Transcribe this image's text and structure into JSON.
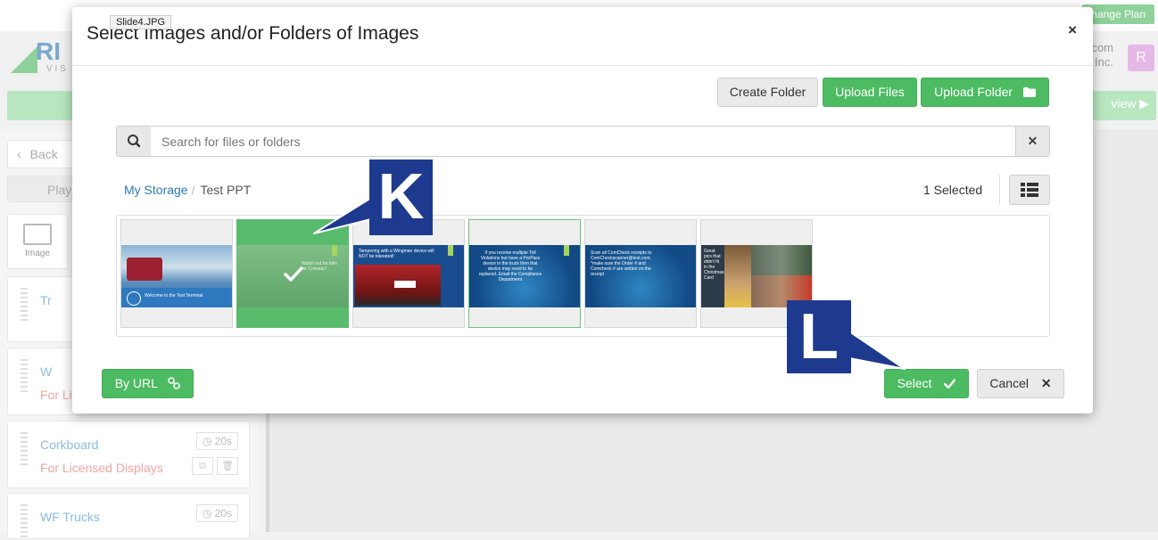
{
  "background": {
    "change_plan": "hange Plan",
    "brand_letters": "RI",
    "brand_sub": "V I S",
    "account_line1": "l.com",
    "account_line2": "t, Inc.",
    "avatar_letter": "R",
    "preview_label": "view ▶",
    "back_label": "Back",
    "play_label": "Play",
    "image_tile_label": "Image",
    "playlist_items": [
      {
        "name": "Tr",
        "sub": "",
        "duration": ""
      },
      {
        "name": "W",
        "sub": "For Li",
        "duration": ""
      },
      {
        "name": "Corkboard",
        "sub": "For Licensed Displays",
        "duration": "20s"
      },
      {
        "name": "WF Trucks",
        "sub": "",
        "duration": "20s"
      }
    ]
  },
  "modal": {
    "tooltip": "Slide4.JPG",
    "title": "Select Images and/or Folders of Images",
    "close": "×",
    "buttons": {
      "create_folder": "Create Folder",
      "upload_files": "Upload Files",
      "upload_folder": "Upload Folder"
    },
    "search": {
      "placeholder": "Search for files or folders",
      "value": ""
    },
    "breadcrumb": {
      "root": "My Storage",
      "separator": "/",
      "current": "Test PPT"
    },
    "selected_count": "1 Selected",
    "thumbnails": [
      {
        "caption": "Welcome to the Test Terminal",
        "state": "normal"
      },
      {
        "caption": "Watch out for tolls for Coinstac!",
        "state": "selected"
      },
      {
        "caption": "Tampering with a Wingman device will NOT be tolerated!",
        "state": "normal"
      },
      {
        "caption": "If you receive multiple Toll Violations but have a PrePass device in the truck then that device may need to be replaced. Email the Compliance Department",
        "state": "hover"
      },
      {
        "caption": "Scan all ComCheck receipts to ComCheckscanner@test.com. *make sure the Order # and Comcheck # are written on the receipt",
        "state": "normal"
      },
      {
        "caption": "Great pics that didn't fit in the Christmas Card",
        "state": "normal"
      }
    ],
    "footer": {
      "by_url": "By URL",
      "select": "Select",
      "cancel": "Cancel"
    }
  },
  "annotations": {
    "k": "K",
    "l": "L"
  },
  "colors": {
    "green": "#4cbb62",
    "link_blue": "#2a7ab8",
    "callout_navy": "#1d3a8f"
  }
}
